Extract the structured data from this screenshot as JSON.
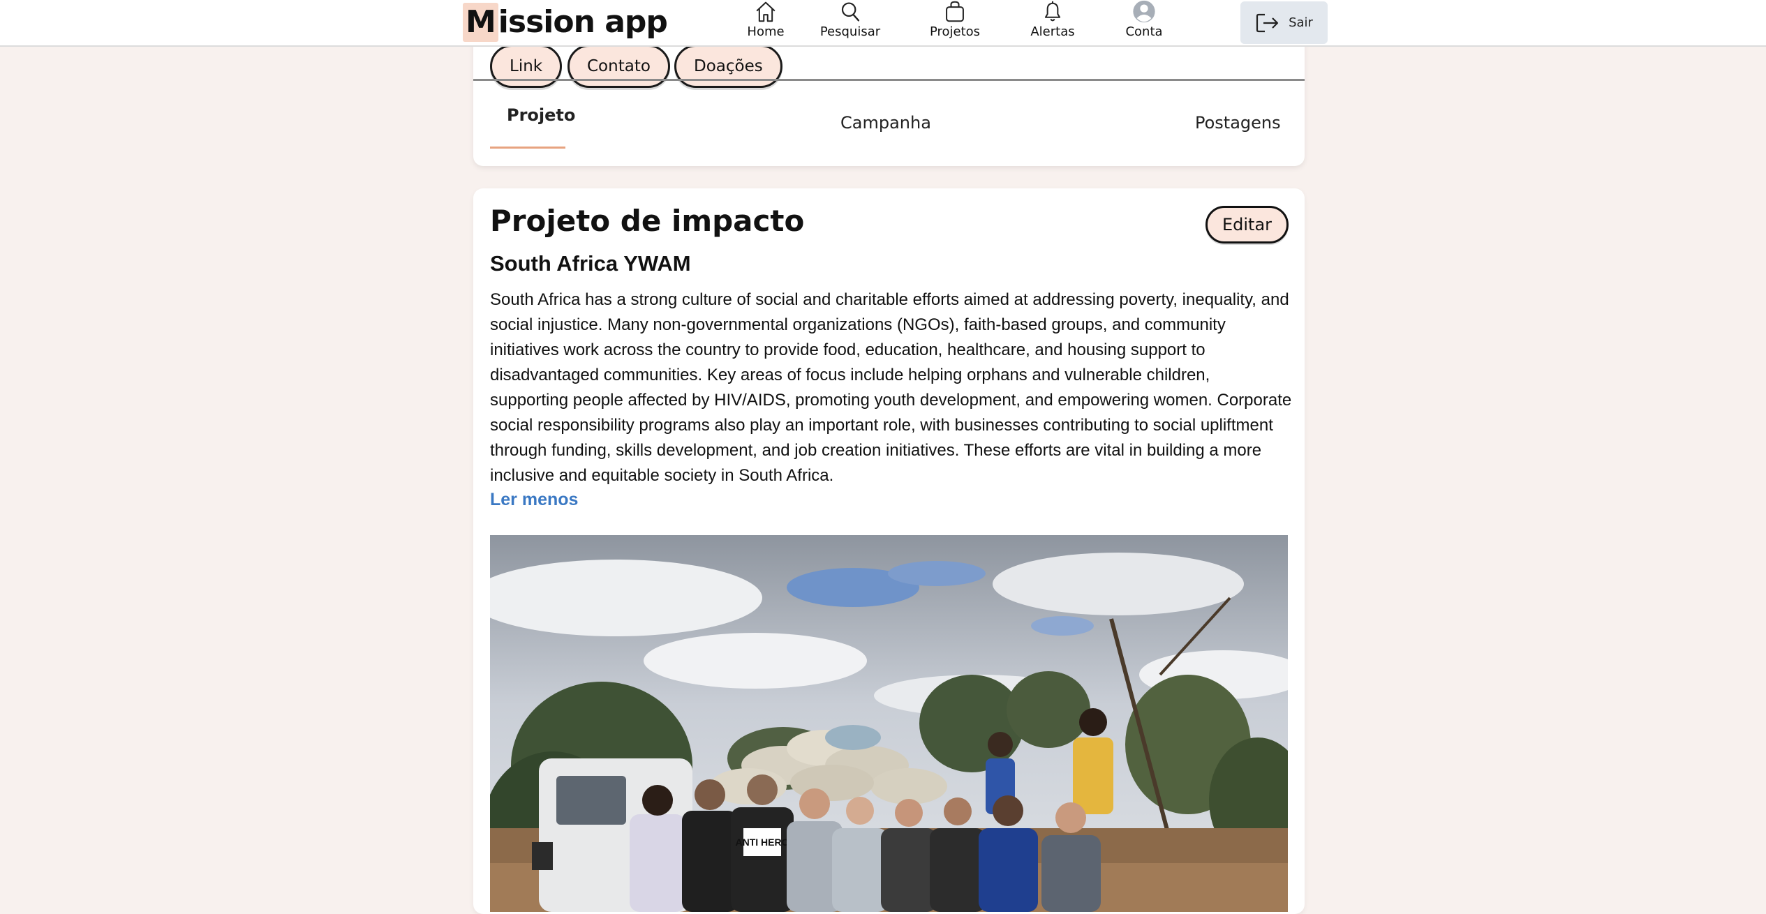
{
  "app": {
    "logo_first_letter": "M",
    "logo_rest": "ission app"
  },
  "nav": {
    "items": [
      {
        "label": "Home",
        "icon": "home-icon"
      },
      {
        "label": "Pesquisar",
        "icon": "search-icon"
      },
      {
        "label": "Projetos",
        "icon": "bag-icon"
      },
      {
        "label": "Alertas",
        "icon": "bell-icon"
      },
      {
        "label": "Conta",
        "icon": "avatar-icon"
      }
    ],
    "logout_label": "Sair",
    "logout_icon": "logout-icon"
  },
  "header": {
    "pills": [
      "Link",
      "Contato",
      "Doações"
    ],
    "tabs": [
      {
        "label": "Projeto",
        "active": true
      },
      {
        "label": "Campanha",
        "active": false
      },
      {
        "label": "Postagens",
        "active": false
      }
    ]
  },
  "project": {
    "title": "Projeto de impacto",
    "edit_label": "Editar",
    "subtitle": "South Africa YWAM",
    "description": "South Africa has a strong culture of social and charitable efforts aimed at addressing poverty, inequality, and social injustice. Many non-governmental organizations (NGOs), faith-based groups, and community initiatives work across the country to provide food, education, healthcare, and housing support to disadvantaged communities. Key areas of focus include helping orphans and vulnerable children, supporting people affected by HIV/AIDS, promoting youth development, and empowering women. Corporate social responsibility programs also play an important role, with businesses contributing to social upliftment through funding, skills development, and job creation initiatives. These efforts are vital in building a more inclusive and equitable society in South Africa.",
    "read_less_label": "Ler menos",
    "photo_shirt_text": "ANTI HERO"
  },
  "colors": {
    "background": "#f8f1ee",
    "accent_pill": "#fbe6dd",
    "link_blue": "#3a78c3",
    "tab_underline": "#e7a380",
    "logout_bg": "#e3e8ee"
  }
}
